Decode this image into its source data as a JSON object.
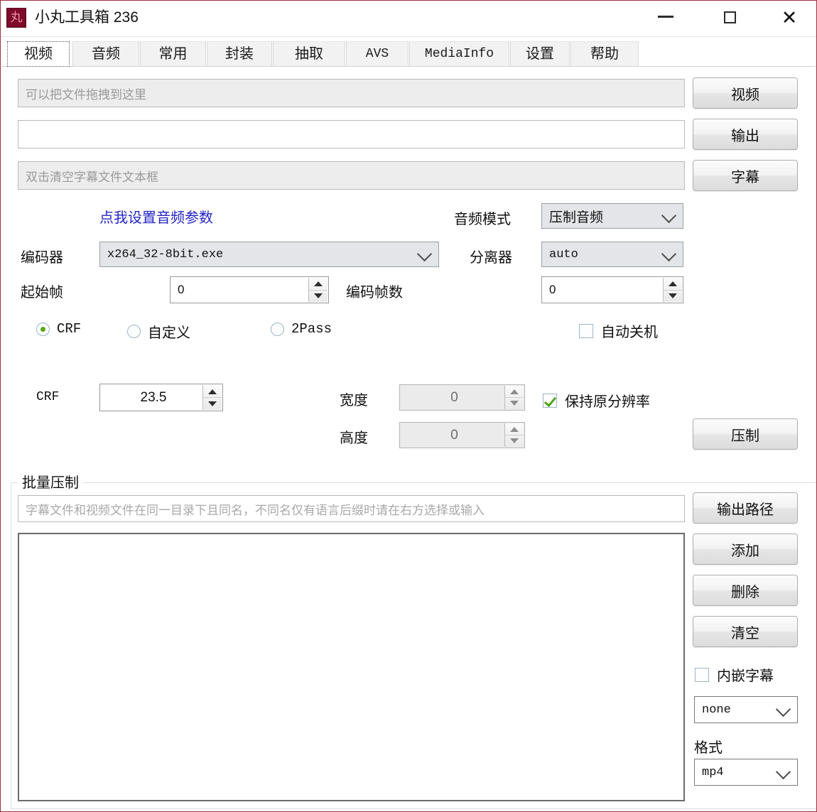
{
  "window": {
    "title": "小丸工具箱 236",
    "icon_glyph": "丸",
    "icon_name": "app-icon",
    "accent_color": "#7c0c29",
    "controls": {
      "minimize": "minimize-icon",
      "maximize": "maximize-icon",
      "close": "close-icon"
    }
  },
  "tabs": [
    {
      "label": "视频",
      "active": true,
      "mono": false
    },
    {
      "label": "音频",
      "active": false,
      "mono": false
    },
    {
      "label": "常用",
      "active": false,
      "mono": false
    },
    {
      "label": "封装",
      "active": false,
      "mono": false
    },
    {
      "label": "抽取",
      "active": false,
      "mono": false
    },
    {
      "label": "AVS",
      "active": false,
      "mono": true
    },
    {
      "label": "MediaInfo",
      "active": false,
      "mono": true
    },
    {
      "label": "设置",
      "active": false,
      "mono": false
    },
    {
      "label": "帮助",
      "active": false,
      "mono": false
    }
  ],
  "video_tab": {
    "input_video": {
      "value": "",
      "placeholder": "可以把文件拖拽到这里"
    },
    "output_file": {
      "value": "",
      "placeholder": ""
    },
    "subtitle_file": {
      "value": "",
      "placeholder": "双击清空字幕文件文本框"
    },
    "buttons": {
      "video": "视频",
      "output": "输出",
      "subtitle": "字幕",
      "encode": "压制"
    },
    "audio_param_link": "点我设置音频参数",
    "labels": {
      "encoder": "编码器",
      "start_frame": "起始帧",
      "frame_count": "编码帧数",
      "audio_mode": "音频模式",
      "demuxer": "分离器",
      "crf": "CRF",
      "width": "宽度",
      "height": "高度"
    },
    "encoder": {
      "value": "x264_32-8bit.exe"
    },
    "audio_mode": {
      "value": "压制音频"
    },
    "demuxer": {
      "value": "auto"
    },
    "start_frame": {
      "value": "0"
    },
    "frame_count": {
      "value": "0"
    },
    "rate_modes": [
      {
        "label": "CRF",
        "selected": true,
        "mono": true
      },
      {
        "label": "自定义",
        "selected": false,
        "mono": false
      },
      {
        "label": "2Pass",
        "selected": false,
        "mono": true
      }
    ],
    "auto_shutdown": {
      "label": "自动关机",
      "checked": false
    },
    "crf_value": {
      "value": "23.5"
    },
    "width_value": {
      "value": "0",
      "disabled": true
    },
    "height_value": {
      "value": "0",
      "disabled": true
    },
    "keep_resolution": {
      "label": "保持原分辨率",
      "checked": true
    }
  },
  "batch": {
    "group_title": "批量压制",
    "subtitle_hint": {
      "value": "",
      "placeholder": "字幕文件和视频文件在同一目录下且同名，不同名仅有语言后缀时请在右方选择或输入"
    },
    "buttons": {
      "output_path": "输出路径",
      "add": "添加",
      "delete": "删除",
      "clear": "清空"
    },
    "embed_subtitle": {
      "label": "内嵌字幕",
      "checked": false
    },
    "subtitle_track": {
      "value": "none"
    },
    "format_label": "格式",
    "format": {
      "value": "mp4"
    },
    "file_list": {
      "items": []
    }
  }
}
